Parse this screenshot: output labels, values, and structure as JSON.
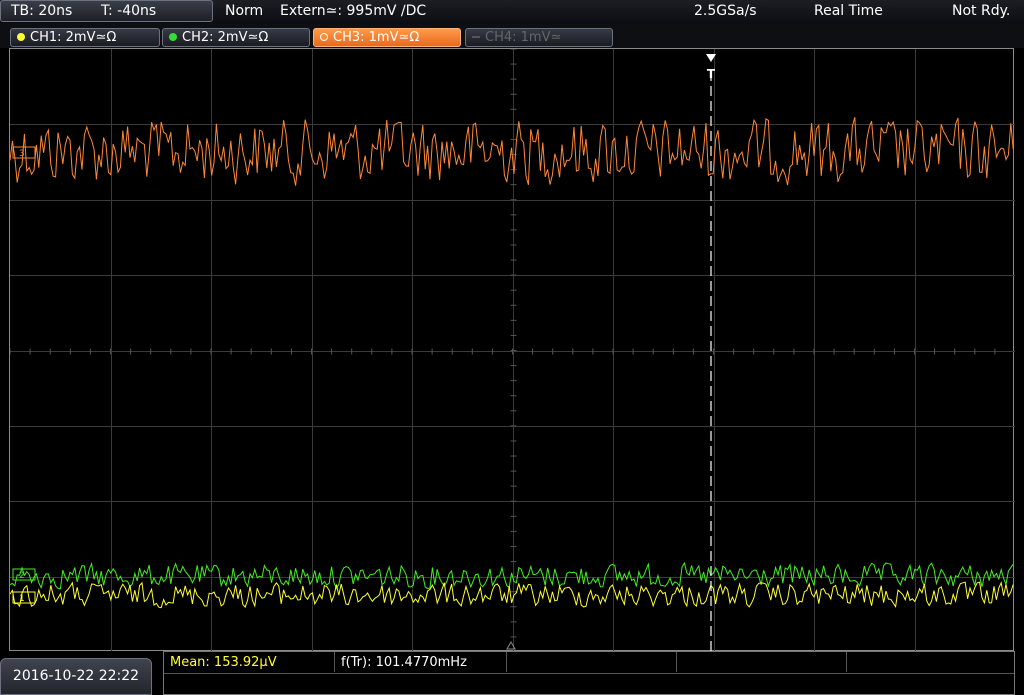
{
  "header": {
    "timebase": "TB: 20ns",
    "trigger_time": "T: -40ns",
    "mode": "Norm",
    "trigger_source": "Extern≃: 995mV ∕DC",
    "sample_rate": "2.5GSa/s",
    "acq_mode": "Real Time",
    "status": "Not Rdy."
  },
  "channels": [
    {
      "label": "CH1: 2mV≃Ω",
      "color": "#ffff33",
      "active": false,
      "enabled": true
    },
    {
      "label": "CH2: 2mV≃Ω",
      "color": "#33dd33",
      "active": false,
      "enabled": true
    },
    {
      "label": "CH3: 1mV≃Ω",
      "color": "#ff8c33",
      "active": true,
      "enabled": true
    },
    {
      "label": "CH4: 1mV≃",
      "color": "#666666",
      "active": false,
      "enabled": false
    }
  ],
  "markers": {
    "trigger": "T",
    "ch3": "3",
    "ch2": "2",
    "ch1": "1"
  },
  "footer": {
    "datetime": "2016-10-22 22:22",
    "measurements": [
      {
        "label": "Mean: 153.92µV",
        "color": "#ffff33"
      },
      {
        "label": "f(Tr): 101.4770mHz",
        "color": "#ffffff"
      }
    ]
  },
  "colors": {
    "grid": "#3a3a3a",
    "ch1": "#ffff33",
    "ch2": "#44ee22",
    "ch3": "#ff8838",
    "trigger_line": "#ffffff"
  }
}
